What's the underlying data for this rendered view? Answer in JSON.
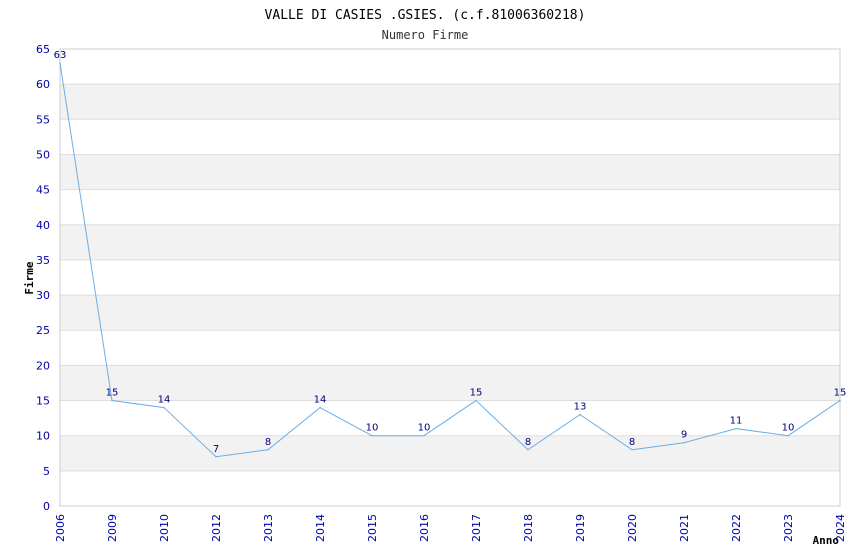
{
  "chart_data": {
    "type": "line",
    "title": "VALLE DI CASIES .GSIES. (c.f.81006360218)",
    "subtitle": "Numero Firme",
    "xlabel": "Anno",
    "ylabel": "Firme",
    "categories": [
      "2006",
      "2009",
      "2010",
      "2012",
      "2013",
      "2014",
      "2015",
      "2016",
      "2017",
      "2018",
      "2019",
      "2020",
      "2021",
      "2022",
      "2023",
      "2024"
    ],
    "series": [
      {
        "values": [
          63,
          15,
          14,
          7,
          8,
          14,
          10,
          10,
          15,
          8,
          13,
          8,
          9,
          11,
          10,
          15
        ]
      }
    ],
    "ylim": [
      0,
      65
    ],
    "yticks": [
      0,
      5,
      10,
      15,
      20,
      25,
      30,
      35,
      40,
      45,
      50,
      55,
      60,
      65
    ],
    "grid": "horizontal alternating bands",
    "colors": {
      "line": "#6aaee8",
      "band": "#f2f2f2",
      "tick_text": "#0000aa",
      "data_label": "#000080"
    }
  }
}
